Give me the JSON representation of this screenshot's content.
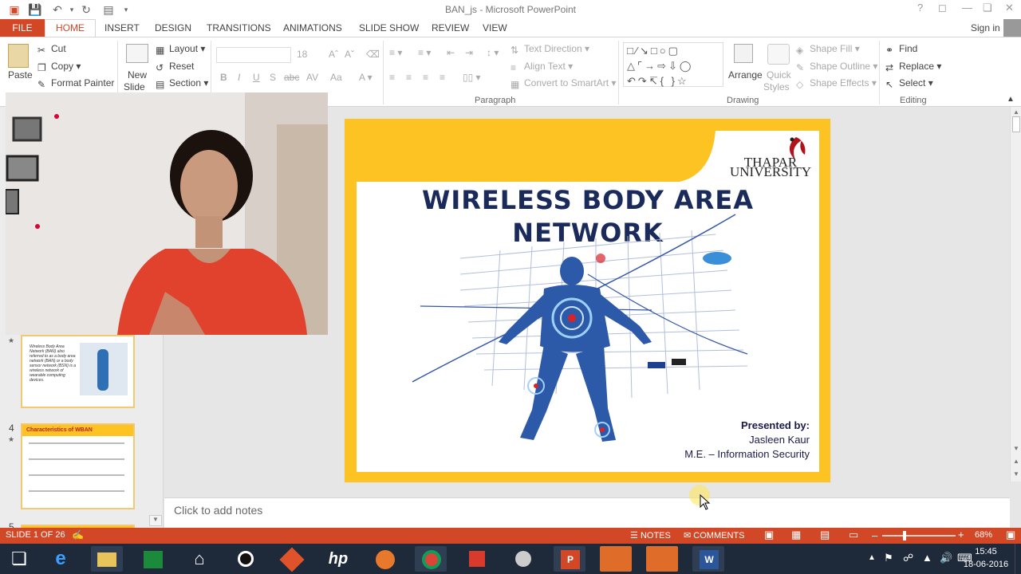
{
  "app": {
    "title": "BAN_js - Microsoft PowerPoint",
    "signin": "Sign in"
  },
  "tabs": {
    "file": "FILE",
    "home": "HOME",
    "items": [
      "INSERT",
      "DESIGN",
      "TRANSITIONS",
      "ANIMATIONS",
      "SLIDE SHOW",
      "REVIEW",
      "VIEW"
    ]
  },
  "ribbon": {
    "clipboard": {
      "paste": "Paste",
      "cut": "Cut",
      "copy": "Copy",
      "format_painter": "Format Painter"
    },
    "slides": {
      "new_slide_1": "New",
      "new_slide_2": "Slide",
      "layout": "Layout",
      "reset": "Reset",
      "section": "Section"
    },
    "font": {
      "size": "18"
    },
    "paragraph": {
      "text_direction": "Text Direction",
      "align_text": "Align Text",
      "convert_smartart": "Convert to SmartArt",
      "group_label": "Paragraph"
    },
    "drawing": {
      "arrange": "Arrange",
      "quick_styles_1": "Quick",
      "quick_styles_2": "Styles",
      "shape_fill": "Shape Fill",
      "shape_outline": "Shape Outline",
      "shape_effects": "Shape Effects",
      "group_label": "Drawing"
    },
    "editing": {
      "find": "Find",
      "replace": "Replace",
      "select": "Select",
      "group_label": "Editing"
    }
  },
  "thumbnails": [
    {
      "number": "",
      "title": "",
      "text": "Wireless Body Area Network (BAN) also referred to as a body area network (BAN) or a body sensor network (BSN) is a wireless network of wearable computing devices."
    },
    {
      "number": "4",
      "title": "Characteristics of WBAN",
      "text": ""
    },
    {
      "number": "5",
      "title": "",
      "text": ""
    }
  ],
  "slide": {
    "logo_line1": "THAPAR",
    "logo_line2": "UNIVERSITY",
    "title_line1": "WIRELESS BODY AREA",
    "title_line2": "NETWORK",
    "presented_by": "Presented by:",
    "presenter": "Jasleen Kaur",
    "program": "M.E. – Information Security"
  },
  "notes": {
    "placeholder": "Click to add notes"
  },
  "status": {
    "slide_counter": "SLIDE 1 OF 26",
    "notes": "NOTES",
    "comments": "COMMENTS",
    "zoom": "68%"
  },
  "taskbar": {
    "time": "15:45",
    "date": "18-06-2016"
  },
  "colors": {
    "accent": "#d24726",
    "slide_frame": "#fdc322",
    "title_text": "#1a2a5a"
  }
}
